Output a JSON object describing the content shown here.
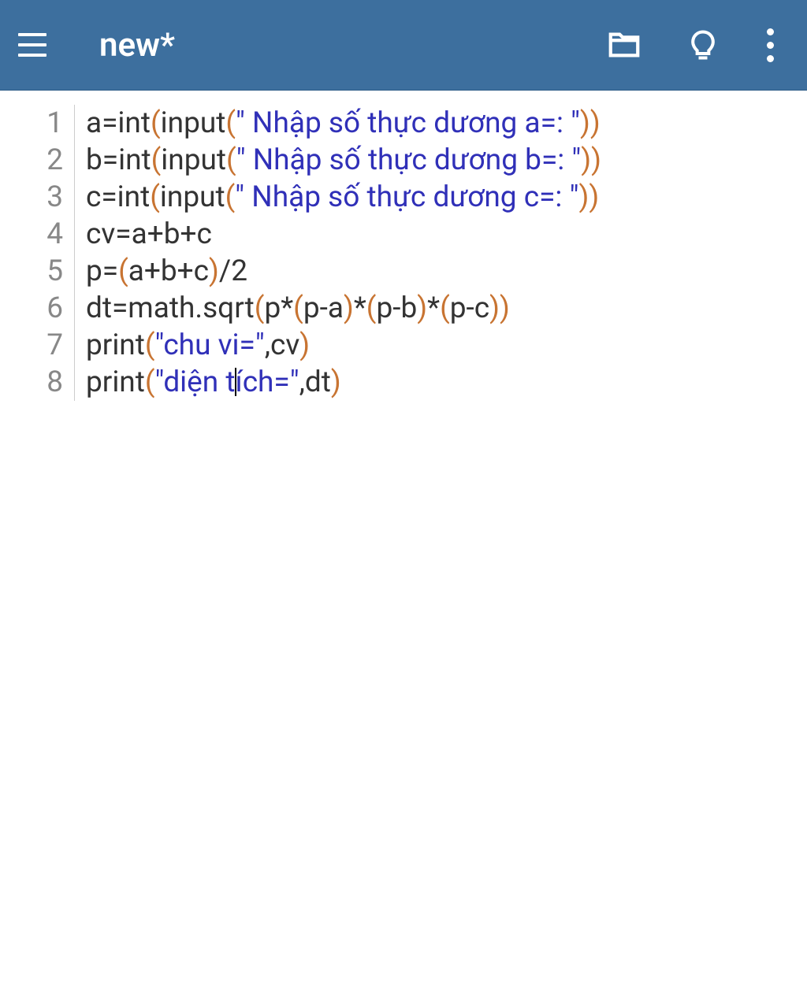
{
  "header": {
    "title": "new*"
  },
  "code": {
    "lines": [
      {
        "num": "1",
        "tokens": [
          {
            "t": "a=int",
            "c": "fn"
          },
          {
            "t": "(",
            "c": "paren"
          },
          {
            "t": "input",
            "c": "fn"
          },
          {
            "t": "(",
            "c": "paren"
          },
          {
            "t": "\" Nhập số thực dương a=: \"",
            "c": "str"
          },
          {
            "t": ")",
            "c": "paren"
          },
          {
            "t": ")",
            "c": "paren"
          }
        ]
      },
      {
        "num": "2",
        "tokens": [
          {
            "t": "b=int",
            "c": "fn"
          },
          {
            "t": "(",
            "c": "paren"
          },
          {
            "t": "input",
            "c": "fn"
          },
          {
            "t": "(",
            "c": "paren"
          },
          {
            "t": "\" Nhập số thực dương b=: \"",
            "c": "str"
          },
          {
            "t": ")",
            "c": "paren"
          },
          {
            "t": ")",
            "c": "paren"
          }
        ]
      },
      {
        "num": "3",
        "tokens": [
          {
            "t": "c=int",
            "c": "fn"
          },
          {
            "t": "(",
            "c": "paren"
          },
          {
            "t": "input",
            "c": "fn"
          },
          {
            "t": "(",
            "c": "paren"
          },
          {
            "t": "\" Nhập số thực dương c=: \"",
            "c": "str"
          },
          {
            "t": ")",
            "c": "paren"
          },
          {
            "t": ")",
            "c": "paren"
          }
        ]
      },
      {
        "num": "4",
        "tokens": [
          {
            "t": "cv=a+b+c",
            "c": "fn"
          }
        ]
      },
      {
        "num": "5",
        "tokens": [
          {
            "t": "p=",
            "c": "fn"
          },
          {
            "t": "(",
            "c": "paren"
          },
          {
            "t": "a+b+c",
            "c": "fn"
          },
          {
            "t": ")",
            "c": "paren"
          },
          {
            "t": "/2",
            "c": "fn"
          }
        ]
      },
      {
        "num": "6",
        "tokens": [
          {
            "t": "dt=math.sqrt",
            "c": "fn"
          },
          {
            "t": "(",
            "c": "paren"
          },
          {
            "t": "p*",
            "c": "fn"
          },
          {
            "t": "(",
            "c": "paren"
          },
          {
            "t": "p-a",
            "c": "fn"
          },
          {
            "t": ")",
            "c": "paren"
          },
          {
            "t": "*",
            "c": "fn"
          },
          {
            "t": "(",
            "c": "paren"
          },
          {
            "t": "p-b",
            "c": "fn"
          },
          {
            "t": ")",
            "c": "paren"
          },
          {
            "t": "*",
            "c": "fn"
          },
          {
            "t": "(",
            "c": "paren"
          },
          {
            "t": "p-c",
            "c": "fn"
          },
          {
            "t": ")",
            "c": "paren"
          },
          {
            "t": ")",
            "c": "paren"
          }
        ]
      },
      {
        "num": "7",
        "tokens": [
          {
            "t": "print",
            "c": "fn"
          },
          {
            "t": "(",
            "c": "paren"
          },
          {
            "t": "\"chu vi=\"",
            "c": "str"
          },
          {
            "t": ",cv",
            "c": "fn"
          },
          {
            "t": ")",
            "c": "paren"
          }
        ]
      },
      {
        "num": "8",
        "tokens": [
          {
            "t": "print",
            "c": "fn"
          },
          {
            "t": "(",
            "c": "paren"
          },
          {
            "t": "\"diện t",
            "c": "str"
          },
          {
            "t": "",
            "c": "caret"
          },
          {
            "t": "ích=\"",
            "c": "str"
          },
          {
            "t": ",dt",
            "c": "fn"
          },
          {
            "t": ")",
            "c": "paren"
          }
        ]
      }
    ]
  }
}
